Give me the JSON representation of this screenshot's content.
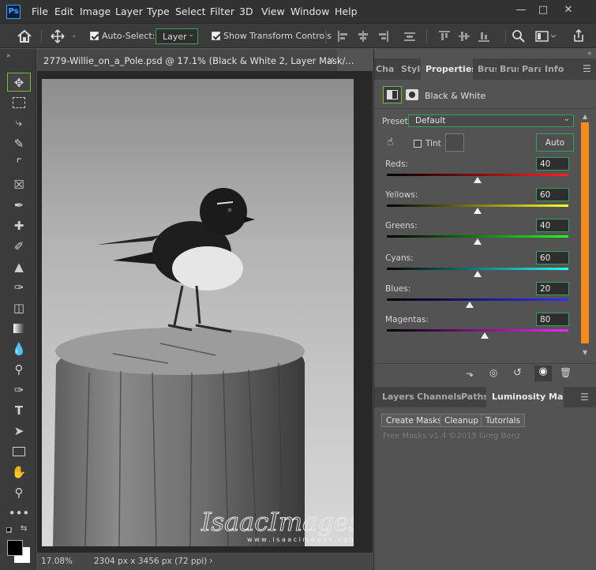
{
  "app": {
    "logo": "Ps"
  },
  "menu": [
    "File",
    "Edit",
    "Image",
    "Layer",
    "Type",
    "Select",
    "Filter",
    "3D",
    "View",
    "Window",
    "Help"
  ],
  "options": {
    "auto_select_label": "Auto-Select:",
    "auto_select_value": "Layer",
    "show_transform_label": "Show Transform Controls"
  },
  "document": {
    "tab_title": "2779-Willie_on_a_Pole.psd @ 17.1% (Black & White 2, Layer Mask/...",
    "zoom": "17.08%",
    "dimensions": "2304 px x 3456 px (72 ppi)",
    "watermark_main": "IsaacImages",
    "watermark_sub": "w w w . i s a a c i m a g e s . c o m"
  },
  "panel_top": {
    "tabs": [
      "Cha",
      "Style",
      "Properties",
      "Brus",
      "Brus",
      "Para",
      "Info"
    ],
    "title": "Black & White",
    "preset_label": "Preset:",
    "preset_value": "Default",
    "tint_label": "Tint",
    "auto_label": "Auto",
    "sliders": [
      {
        "label": "Reds:",
        "value": "40"
      },
      {
        "label": "Yellows:",
        "value": "60"
      },
      {
        "label": "Greens:",
        "value": "40"
      },
      {
        "label": "Cyans:",
        "value": "60"
      },
      {
        "label": "Blues:",
        "value": "20"
      },
      {
        "label": "Magentas:",
        "value": "80"
      }
    ]
  },
  "panel_bottom": {
    "tabs": [
      "Layers",
      "Channels",
      "Paths",
      "Luminosity Masks"
    ],
    "buttons": [
      "Create Masks",
      "Cleanup",
      "Tutorials"
    ],
    "credit": "Free Masks v1.4 ©2015 Greg Benz"
  },
  "colors": {
    "accent_green": "#31a85b",
    "scroll_orange": "#f58a1f",
    "ps_blue": "#31a8ff"
  }
}
